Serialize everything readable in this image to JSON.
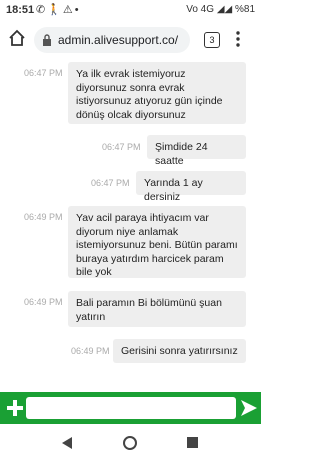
{
  "status_bar": {
    "time": "18:51",
    "network": "Vo 4G",
    "battery": "%81",
    "icons": [
      "whatsapp-icon",
      "walking-icon",
      "signal-alert-icon",
      "dot-icon"
    ]
  },
  "browser": {
    "url": "admin.alivesupport.co/",
    "tab_count": "3"
  },
  "messages": [
    {
      "time": "06:47 PM",
      "text": "Ya ilk evrak istemiyoruz diyorsunuz sonra evrak istiyorsunuz atıyoruz gün içinde dönüş olcak diyorsunuz",
      "side": "left"
    },
    {
      "time": "06:47 PM",
      "text": "Şimdide 24 saatte",
      "side": "right"
    },
    {
      "time": "06:47 PM",
      "text": "Yarında 1 ay dersiniz",
      "side": "right"
    },
    {
      "time": "06:49 PM",
      "text": "Yav acil paraya ihtiyacım var diyorum niye anlamak istemiyorsunuz beni. Bütün paramı buraya yatırdım harcicek param bile yok",
      "side": "left"
    },
    {
      "time": "06:49 PM",
      "text": "Bali paramın Bi bölümünü şuan yatırın",
      "side": "left"
    },
    {
      "time": "06:49 PM",
      "text": "Gerisini sonra yatırırsınız",
      "side": "right"
    }
  ],
  "composer": {
    "placeholder": "",
    "color": "#1aa034"
  }
}
